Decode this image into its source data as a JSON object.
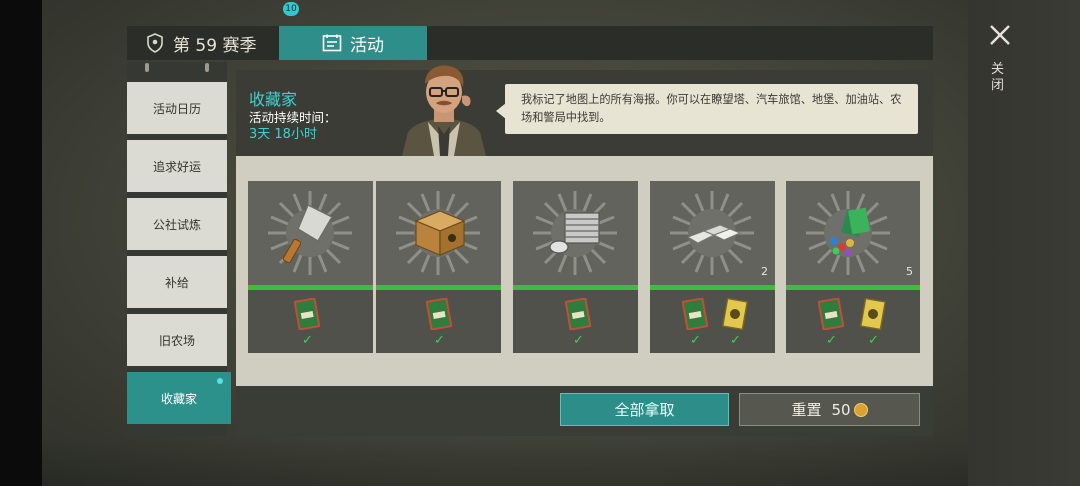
{
  "tabs": {
    "season_label": "第 59 赛季",
    "activity_label": "活动",
    "activity_badge": "10"
  },
  "sidebar": {
    "items": [
      {
        "label": "活动日历"
      },
      {
        "label": "追求好运"
      },
      {
        "label": "公社试炼"
      },
      {
        "label": "补给"
      },
      {
        "label": "旧农场"
      },
      {
        "label": "收藏家"
      }
    ],
    "active_index": 5
  },
  "event": {
    "title": "收藏家",
    "duration_label": "活动持续时间：",
    "duration_value": "3天 18小时",
    "npc_speech": "我标记了地图上的所有海报。你可以在瞭望塔、汽车旅馆、地堡、加油站、农场和警局中找到。"
  },
  "rewards": [
    {
      "item_icon": "cleaver-icon",
      "count": "",
      "conditions": [
        "green-poster-icon"
      ]
    },
    {
      "item_icon": "cardboard-box-icon",
      "count": "",
      "conditions": [
        "green-poster-icon"
      ]
    },
    {
      "item_icon": "engine-cylinder-icon",
      "count": "",
      "conditions": [
        "green-poster-icon"
      ]
    },
    {
      "item_icon": "metal-ingots-icon",
      "count": "2",
      "conditions": [
        "green-poster-icon",
        "yellow-poster-icon"
      ]
    },
    {
      "item_icon": "gems-and-cards-icon",
      "count": "5",
      "conditions": [
        "green-poster-icon",
        "yellow-poster-icon"
      ]
    }
  ],
  "actions": {
    "claim_all_label": "全部拿取",
    "reset_label": "重置",
    "reset_cost": "50"
  },
  "close": {
    "label": "关闭"
  },
  "colors": {
    "accent_teal": "#2d8e89",
    "highlight_cyan": "#3ed2d3",
    "progress_green": "#3bbf3b"
  }
}
